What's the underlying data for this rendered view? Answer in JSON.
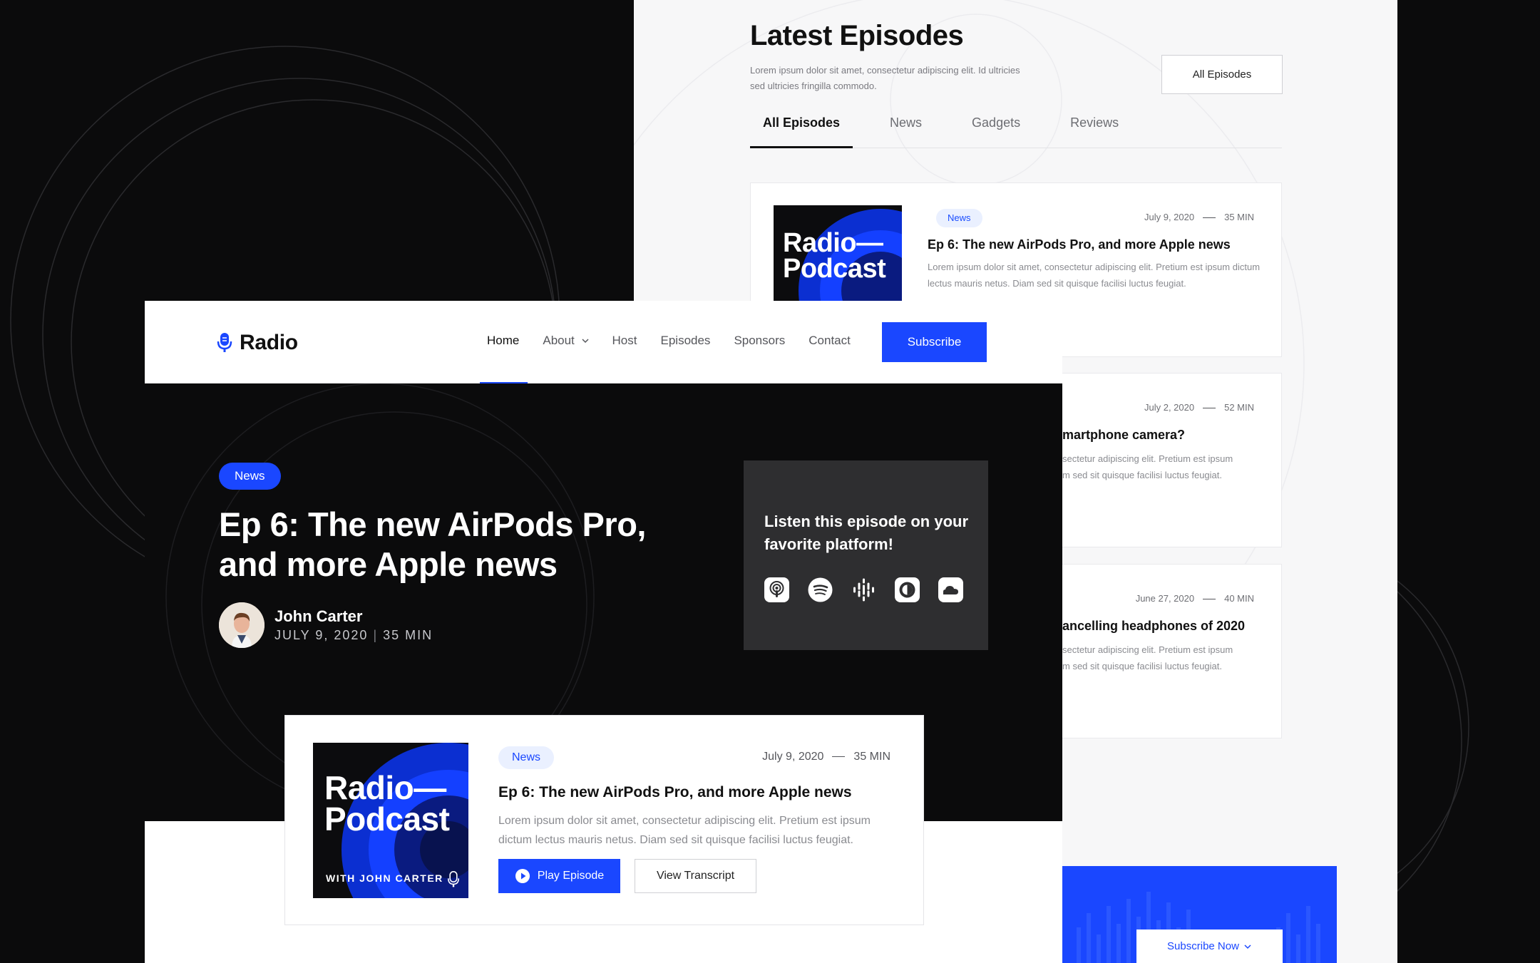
{
  "back_page": {
    "title": "Latest Episodes",
    "lead": "Lorem ipsum dolor sit amet, consectetur adipiscing elit. Id ultricies sed ultricies fringilla commodo.",
    "all_button": "All Episodes",
    "tabs": [
      {
        "label": "All Episodes"
      },
      {
        "label": "News"
      },
      {
        "label": "Gadgets"
      },
      {
        "label": "Reviews"
      }
    ],
    "episodes": [
      {
        "tag": "News",
        "date": "July 9, 2020",
        "duration": "35 MIN",
        "title": "Ep 6: The new AirPods Pro, and more Apple news",
        "desc": "Lorem ipsum dolor sit amet, consectetur adipiscing elit. Pretium est ipsum dictum lectus mauris netus. Diam sed sit quisque facilisi luctus feugiat.",
        "cover_line1": "Radio—",
        "cover_line2": "Podcast"
      },
      {
        "date": "July 2, 2020",
        "duration": "52 MIN",
        "title_visible": "martphone camera?",
        "desc_line1": "sectetur adipiscing elit. Pretium est ipsum",
        "desc_line2": "m sed sit quisque facilisi luctus feugiat."
      },
      {
        "date": "June 27, 2020",
        "duration": "40 MIN",
        "title_visible": "ancelling headphones of 2020",
        "desc_line1": "sectetur adipiscing elit. Pretium est ipsum",
        "desc_line2": "m sed sit quisque facilisi luctus feugiat."
      }
    ],
    "subscribe_now": "Subscribe Now"
  },
  "nav": {
    "logo": "Radio",
    "items": [
      {
        "label": "Home"
      },
      {
        "label": "About"
      },
      {
        "label": "Host"
      },
      {
        "label": "Episodes"
      },
      {
        "label": "Sponsors"
      },
      {
        "label": "Contact"
      }
    ],
    "subscribe": "Subscribe"
  },
  "hero": {
    "tag": "News",
    "title": "Ep 6: The new AirPods Pro, and more Apple news",
    "author": "John Carter",
    "date": "JULY 9, 2020",
    "duration": "35 MIN",
    "listen_text": "Listen this episode on your favorite platform!",
    "platforms": [
      "apple-podcasts-icon",
      "spotify-icon",
      "google-podcasts-icon",
      "overcast-icon",
      "soundcloud-icon"
    ]
  },
  "featured": {
    "cover_line1": "Radio—",
    "cover_line2": "Podcast",
    "cover_host": "WITH JOHN CARTER",
    "tag": "News",
    "date": "July 9, 2020",
    "duration": "35 MIN",
    "title": "Ep 6: The new AirPods Pro, and more Apple news",
    "desc": "Lorem ipsum dolor sit amet, consectetur adipiscing elit. Pretium est ipsum dictum lectus mauris netus. Diam sed sit quisque facilisi luctus feugiat.",
    "play": "Play Episode",
    "transcript": "View Transcript"
  },
  "colors": {
    "accent": "#1a47ff",
    "dark": "#0b0b0c",
    "panel": "#2e2e30"
  }
}
